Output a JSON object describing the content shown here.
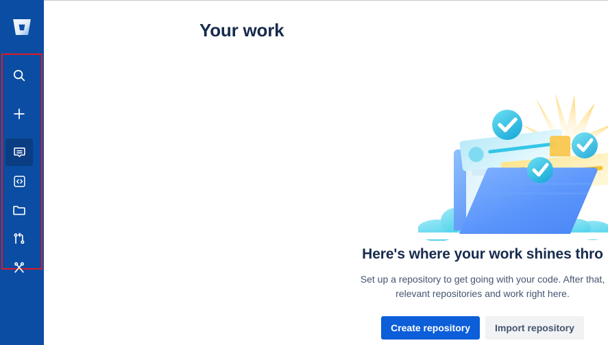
{
  "app": {
    "name": "Bitbucket",
    "logo_icon": "bitbucket-logo-icon"
  },
  "sidebar": {
    "background_color": "#0b4da2",
    "highlight_box_color": "#e01b24",
    "items": [
      {
        "id": "search",
        "icon": "search-icon",
        "label": "Search",
        "active": false
      },
      {
        "id": "create",
        "icon": "plus-icon",
        "label": "Create",
        "active": false
      },
      {
        "id": "your-work",
        "icon": "your-work-icon",
        "label": "Your work",
        "active": true
      },
      {
        "id": "code",
        "icon": "code-brackets-icon",
        "label": "Code",
        "active": false
      },
      {
        "id": "repositories",
        "icon": "folder-icon",
        "label": "Repositories",
        "active": false
      },
      {
        "id": "pull-requests",
        "icon": "pull-request-icon",
        "label": "Pull requests",
        "active": false
      },
      {
        "id": "snippets",
        "icon": "scissors-icon",
        "label": "Snippets",
        "active": false
      }
    ]
  },
  "main": {
    "page_title": "Your work",
    "empty_state": {
      "illustration_icon": "work-folder-illustration",
      "heading": "Here's where your work shines thro",
      "body_line_1": "Set up a repository to get going with your code. After that,",
      "body_line_2": "relevant repositories and work right here.",
      "primary_button": "Create repository",
      "secondary_button": "Import repository",
      "primary_button_color": "#0c5ed9",
      "secondary_button_color": "#f1f2f4"
    }
  }
}
